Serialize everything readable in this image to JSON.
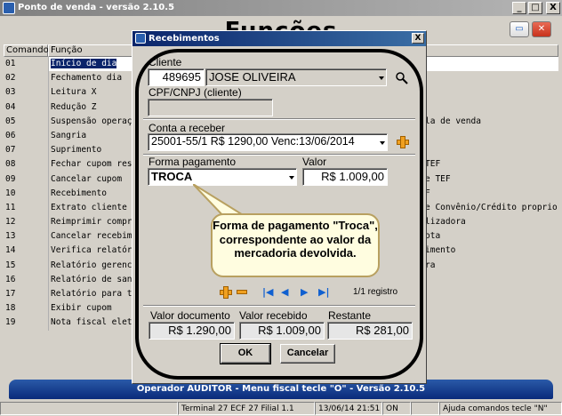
{
  "main_window": {
    "title": "Ponto de venda - versão 2.10.5",
    "controls": [
      "_",
      "□",
      "X"
    ]
  },
  "header": {
    "title": "Funções"
  },
  "grid": {
    "columns": [
      "Comando",
      "Função"
    ],
    "rows": [
      {
        "cmd": "01",
        "fn": "Início de dia",
        "right": ""
      },
      {
        "cmd": "02",
        "fn": "Fechamento dia",
        "right": ""
      },
      {
        "cmd": "03",
        "fn": "Leitura X",
        "right": ""
      },
      {
        "cmd": "04",
        "fn": "Redução Z",
        "right": ""
      },
      {
        "cmd": "05",
        "fn": "Suspensão operaçã",
        "right": "la de venda"
      },
      {
        "cmd": "06",
        "fn": "Sangria",
        "right": ""
      },
      {
        "cmd": "07",
        "fn": "Suprimento",
        "right": ""
      },
      {
        "cmd": "08",
        "fn": "Fechar cupom resu",
        "right": "TEF"
      },
      {
        "cmd": "09",
        "fn": "Cancelar cupom",
        "right": "e TEF"
      },
      {
        "cmd": "10",
        "fn": "Recebimento",
        "right": "F"
      },
      {
        "cmd": "11",
        "fn": "Extrato cliente",
        "right": "e Convênio/Crédito proprio"
      },
      {
        "cmd": "12",
        "fn": "Reimprimir compro",
        "right": "lizadora"
      },
      {
        "cmd": "13",
        "fn": "Cancelar recebime",
        "right": "ota"
      },
      {
        "cmd": "14",
        "fn": "Verifica relatóri",
        "right": "imento"
      },
      {
        "cmd": "15",
        "fn": "Relatório gerenci",
        "right": "ra"
      },
      {
        "cmd": "16",
        "fn": "Relatório de sanç",
        "right": ""
      },
      {
        "cmd": "17",
        "fn": "Relatório para tr",
        "right": ""
      },
      {
        "cmd": "18",
        "fn": "Exibir cupom",
        "right": ""
      },
      {
        "cmd": "19",
        "fn": "Nota fiscal eletr",
        "right": ""
      }
    ]
  },
  "dialog": {
    "title": "Recebimentos",
    "close": "X",
    "cliente_label": "Cliente",
    "cliente_code": "489695",
    "cliente_name": "JOSE OLIVEIRA",
    "cpf_label": "CPF/CNPJ (cliente)",
    "cpf_value": "",
    "conta_label": "Conta a receber",
    "conta_value": "25001-55/1  R$ 1290,00 Venc:13/06/2014",
    "forma_label": "Forma pagamento",
    "forma_value": "TROCA",
    "valor_label": "Valor",
    "valor_value": "R$ 1.009,00",
    "callout": "Forma de pagamento \"Troca\", correspondente ao valor da mercadoria devolvida.",
    "registro": "1/1 registro",
    "valor_documento_label": "Valor documento",
    "valor_documento": "R$ 1.290,00",
    "valor_recebido_label": "Valor recebido",
    "valor_recebido": "R$ 1.009,00",
    "restante_label": "Restante",
    "restante": "R$ 281,00",
    "ok": "OK",
    "cancelar": "Cancelar"
  },
  "operator_bar": "Operador AUDITOR - Menu fiscal tecle \"O\" - Versão 2.10.5",
  "statusbar": [
    "",
    "Terminal 27 ECF 27 Filial 1.1",
    "13/06/14 21:51",
    "ON",
    "",
    "Ajuda comandos tecle \"N\""
  ],
  "colors": {
    "title_gradient": "#0a246a",
    "operator_bar": "#0a2a7a",
    "callout_border": "#b8a060"
  }
}
